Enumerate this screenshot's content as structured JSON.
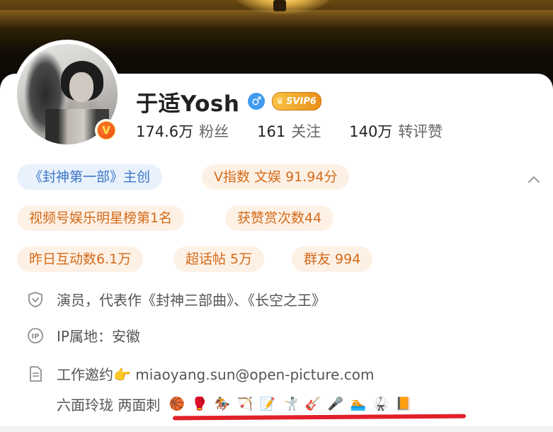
{
  "profile": {
    "name": "于适Yosh",
    "gender_icon": "male-icon",
    "gender_symbol": "♂",
    "svip_label": "SVIP6",
    "verified_badge": "V",
    "stats": [
      {
        "num": "174.6万",
        "label": "粉丝"
      },
      {
        "num": "161",
        "label": "关注"
      },
      {
        "num": "140万",
        "label": "转评赞"
      }
    ]
  },
  "tags": [
    {
      "label": "《封神第一部》主创",
      "style": "blue"
    },
    {
      "label": "V指数 文娱 91.94分",
      "style": "orange"
    },
    {
      "label": "视频号娱乐明星榜第1名",
      "style": "orange"
    },
    {
      "label": "获赞赏次数44",
      "style": "orange"
    },
    {
      "label": "昨日互动数6.1万",
      "style": "orange"
    },
    {
      "label": "超话帖 5万",
      "style": "orange"
    },
    {
      "label": "群友 994",
      "style": "orange"
    }
  ],
  "info": {
    "occupation": "演员，代表作《封神三部曲》、《长空之王》",
    "ip_location": "IP属地：安徽",
    "work_contact": "工作邀约👉 miaoyang.sun@open-picture.com",
    "bio_text": "六面玲珑 两面刺",
    "bio_emojis": [
      "🏀",
      "🥊",
      "🏇",
      "🏹",
      "📝",
      "🤺",
      "🎸",
      "🎤",
      "🏊",
      "🥋",
      "📙"
    ]
  },
  "colors": {
    "tag_blue_bg": "#e9f2fc",
    "tag_blue_text": "#3a74c8",
    "tag_orange_bg": "#fdf1e6",
    "tag_orange_text": "#d46a18",
    "underline": "#e2202a",
    "gender_blue": "#3f9bf0"
  }
}
